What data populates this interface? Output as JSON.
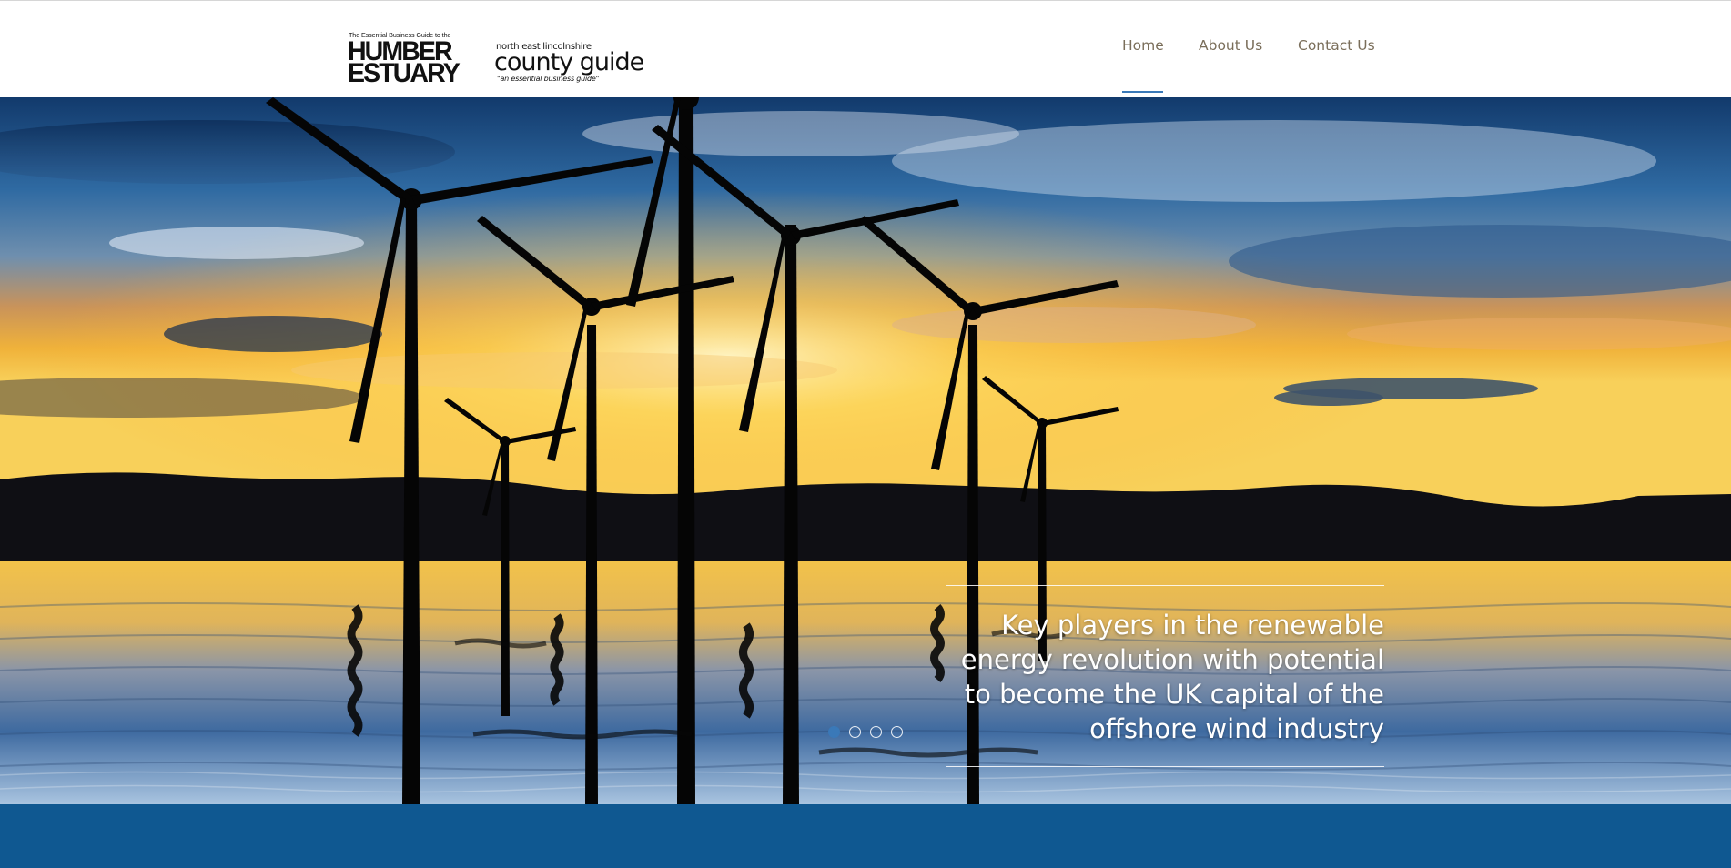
{
  "logos": {
    "humber": {
      "tagline": "The Essential Business Guide to the",
      "line1": "HUMBER",
      "line2": "ESTUARY"
    },
    "county": {
      "top": "north east   lincolnshire",
      "main": "county guide",
      "sub": "\"an essential business guide\""
    }
  },
  "nav": {
    "items": [
      {
        "label": "Home",
        "active": true
      },
      {
        "label": "About Us",
        "active": false
      },
      {
        "label": "Contact Us",
        "active": false
      }
    ]
  },
  "hero": {
    "caption": "Key players in the renewable energy revolution with potential to become the UK capital of the offshore wind industry",
    "slides": 4,
    "active_slide": 1
  },
  "colors": {
    "accent": "#3a79b8",
    "nav_text": "#7a6e5a",
    "band": "#0f5891"
  }
}
